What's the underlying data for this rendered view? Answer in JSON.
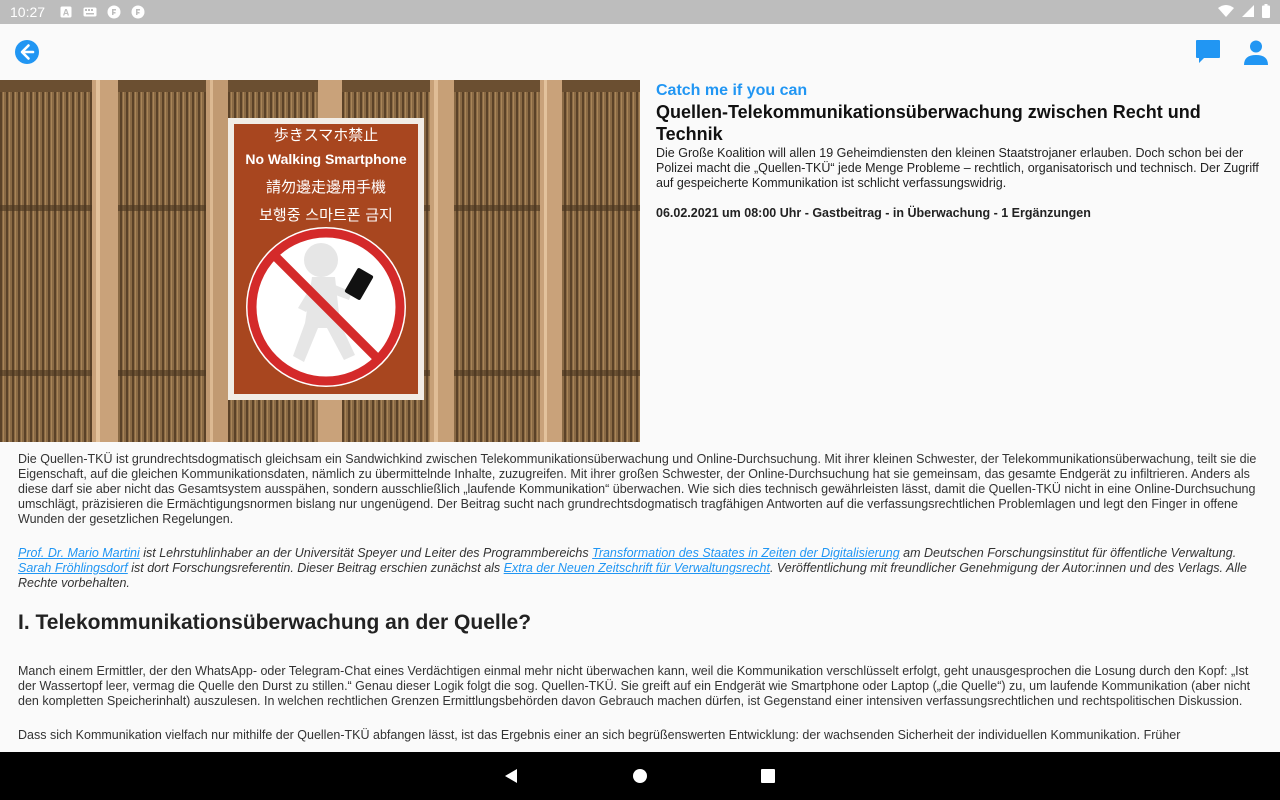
{
  "status": {
    "time": "10:27"
  },
  "icons": {
    "back": "arrow-left-circle-icon",
    "chat": "chat-bubble-icon",
    "user": "user-icon"
  },
  "colors": {
    "accent": "#2196f3",
    "status_bar": "#bdbdbd",
    "nav_bar": "#000000"
  },
  "article": {
    "kicker": "Catch me if you can",
    "title": "Quellen-Telekommunikationsüberwachung zwischen Recht und Technik",
    "lead": "Die Große Koalition will allen 19 Geheimdiensten den kleinen Staatstrojaner erlauben. Doch schon bei der Polizei macht die „Quellen-TKÜ“ jede Menge Probleme – rechtlich, organisatorisch und technisch. Der Zugriff auf gespeicherte Kommunikation ist schlicht verfassungswidrig.",
    "meta": "06.02.2021 um 08:00 Uhr - Gastbeitrag - in Überwachung - 1 Ergänzungen",
    "sign": {
      "line1": "歩きスマホ禁止",
      "line2": "No Walking Smartphone",
      "line3": "請勿邊走邊用手機",
      "line4": "보행중 스마트폰 금지"
    },
    "intro": "Die Quellen-TKÜ ist grundrechtsdogmatisch gleichsam ein Sandwichkind zwischen Telekommunikationsüberwachung und Online-Durchsuchung. Mit ihrer kleinen Schwester, der Telekommunikationsüberwachung, teilt sie die Eigenschaft, auf die gleichen Kommunikationsdaten, nämlich zu übermittelnde Inhalte, zuzugreifen. Mit ihrer großen Schwester, der Online-Durchsuchung hat sie gemeinsam, das gesamte Endgerät zu infiltrieren. Anders als diese darf sie aber nicht das Gesamtsystem ausspähen, sondern ausschließlich „laufende Kommunikation“ überwachen. Wie sich dies technisch gewährleisten lässt, damit die Quellen-TKÜ nicht in eine Online-Durchsuchung umschlägt, präzisieren die Ermächtigungsnormen bislang nur ungenügend. Der Beitrag sucht nach grundrechtsdogmatisch tragfähigen Antworten auf die verfassungsrechtlichen Problemlagen und legt den Finger in offene Wunden der gesetzlichen Regelungen.",
    "author_note": {
      "link1": "Prof. Dr. Mario Martini",
      "text1": " ist Lehrstuhlinhaber an der Universität Speyer und Leiter des Programmbereichs ",
      "link2": "Transformation des Staates in Zeiten der Digitalisierung",
      "text2": " am Deutschen Forschungsinstitut für öffentliche Verwaltung. ",
      "link3": "Sarah Fröhlingsdorf",
      "text3": " ist dort Forschungsreferentin. Dieser Beitrag erschien zunächst als ",
      "link4": "Extra der Neuen Zeitschrift für Verwaltungsrecht",
      "text4": ". Veröffentlichung mit freundlicher Genehmigung der Autor:innen und des Verlags. Alle Rechte vorbehalten."
    },
    "section1_heading": "I. Telekommunikationsüberwachung an der Quelle?",
    "section1_p1": "Manch einem Ermittler, der den WhatsApp- oder Telegram-Chat eines Verdächtigen einmal mehr nicht überwachen kann, weil die Kommunikation verschlüsselt erfolgt, geht unausgesprochen die Losung durch den Kopf: „Ist der Wassertopf leer, vermag die Quelle den Durst zu stillen.“ Genau dieser Logik folgt die sog. Quellen-TKÜ. Sie greift auf ein Endgerät wie Smartphone oder Laptop („die Quelle“) zu, um laufende Kommunikation (aber nicht den kompletten Speicherinhalt) auszulesen. In welchen rechtlichen Grenzen Ermittlungsbehörden davon Gebrauch machen dürfen, ist Gegenstand einer intensiven verfassungsrechtlichen und rechtspolitischen Diskussion.",
    "section1_p2": "Dass sich Kommunikation vielfach nur mithilfe der Quellen-TKÜ abfangen lässt, ist das Ergebnis einer an sich begrüßenswerten Entwicklung: der wachsenden Sicherheit der individuellen Kommunikation. Früher"
  }
}
